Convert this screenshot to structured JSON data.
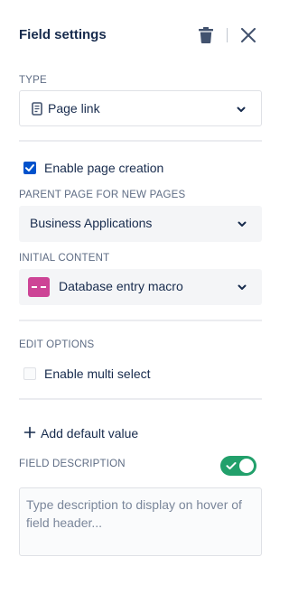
{
  "panel": {
    "title": "Field settings"
  },
  "type_section": {
    "label": "TYPE",
    "value": "Page link",
    "icon": "page-icon"
  },
  "enable_page_creation": {
    "label": "Enable page creation",
    "checked": true
  },
  "parent_page": {
    "label": "PARENT PAGE FOR NEW PAGES",
    "value": "Business Applications"
  },
  "initial_content": {
    "label": "INITIAL CONTENT",
    "value": "Database entry macro",
    "icon_color": "#cd4496"
  },
  "edit_options": {
    "label": "EDIT OPTIONS",
    "multi_select_label": "Enable multi select",
    "multi_select_checked": false
  },
  "default_value": {
    "add_label": "Add default value"
  },
  "field_description": {
    "label": "FIELD DESCRIPTION",
    "toggle_on": true,
    "toggle_color": "#22a06b",
    "placeholder": "Type description to display on hover of field header..."
  },
  "colors": {
    "accent": "#0052cc",
    "text": "#172b4d",
    "muted": "#5e6c84"
  }
}
